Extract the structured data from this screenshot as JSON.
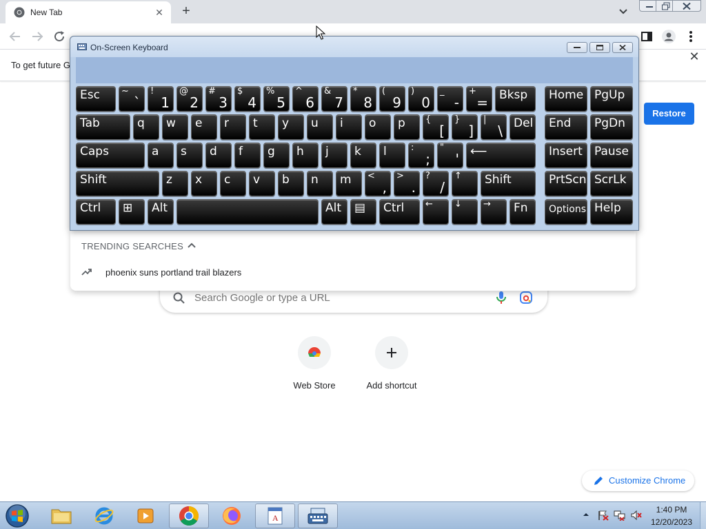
{
  "browser": {
    "tab_title": "New Tab",
    "infobar_text": "To get future G",
    "restore_label": "Restore"
  },
  "osk": {
    "title": "On-Screen Keyboard",
    "rows": [
      [
        {
          "label": "Esc",
          "w": 58
        },
        {
          "top": "~",
          "bot": "`",
          "w": 38
        },
        {
          "top": "!",
          "bot": "1",
          "w": 38
        },
        {
          "top": "@",
          "bot": "2",
          "w": 38
        },
        {
          "top": "#",
          "bot": "3",
          "w": 38
        },
        {
          "top": "$",
          "bot": "4",
          "w": 38
        },
        {
          "top": "%",
          "bot": "5",
          "w": 38
        },
        {
          "top": "^",
          "bot": "6",
          "w": 38
        },
        {
          "top": "&",
          "bot": "7",
          "w": 38
        },
        {
          "top": "*",
          "bot": "8",
          "w": 38
        },
        {
          "top": "(",
          "bot": "9",
          "w": 38
        },
        {
          "top": ")",
          "bot": "0",
          "w": 38
        },
        {
          "top": "_",
          "bot": "-",
          "w": 38
        },
        {
          "top": "+",
          "bot": "=",
          "w": 38
        },
        {
          "label": "Bksp",
          "w": 59
        },
        {
          "label": "Home",
          "w": 62,
          "gap": 9
        },
        {
          "label": "PgUp",
          "w": 62
        }
      ],
      [
        {
          "label": "Tab",
          "w": 79
        },
        {
          "label": "q",
          "w": 38
        },
        {
          "label": "w",
          "w": 38
        },
        {
          "label": "e",
          "w": 38
        },
        {
          "label": "r",
          "w": 38
        },
        {
          "label": "t",
          "w": 38
        },
        {
          "label": "y",
          "w": 38
        },
        {
          "label": "u",
          "w": 38
        },
        {
          "label": "i",
          "w": 38
        },
        {
          "label": "o",
          "w": 38
        },
        {
          "label": "p",
          "w": 38
        },
        {
          "top": "{",
          "bot": "[",
          "w": 38
        },
        {
          "top": "}",
          "bot": "]",
          "w": 38
        },
        {
          "top": "|",
          "bot": "\\",
          "w": 38
        },
        {
          "label": "Del",
          "w": 38
        },
        {
          "label": "End",
          "w": 62,
          "gap": 9
        },
        {
          "label": "PgDn",
          "w": 62
        }
      ],
      [
        {
          "label": "Caps",
          "w": 100
        },
        {
          "label": "a",
          "w": 38
        },
        {
          "label": "s",
          "w": 38
        },
        {
          "label": "d",
          "w": 38
        },
        {
          "label": "f",
          "w": 38
        },
        {
          "label": "g",
          "w": 38
        },
        {
          "label": "h",
          "w": 38
        },
        {
          "label": "j",
          "w": 38
        },
        {
          "label": "k",
          "w": 38
        },
        {
          "label": "l",
          "w": 38
        },
        {
          "top": ":",
          "bot": ";",
          "w": 38
        },
        {
          "top": "\"",
          "bot": "'",
          "w": 38
        },
        {
          "label": "⟵",
          "w": 101,
          "icon": "enter-icon"
        },
        {
          "label": "Insert",
          "w": 62,
          "gap": 9
        },
        {
          "label": "Pause",
          "w": 62
        }
      ],
      [
        {
          "label": "Shift",
          "w": 121
        },
        {
          "label": "z",
          "w": 38
        },
        {
          "label": "x",
          "w": 38
        },
        {
          "label": "c",
          "w": 38
        },
        {
          "label": "v",
          "w": 38
        },
        {
          "label": "b",
          "w": 38
        },
        {
          "label": "n",
          "w": 38
        },
        {
          "label": "m",
          "w": 38
        },
        {
          "top": "<",
          "bot": ",",
          "w": 38
        },
        {
          "top": ">",
          "bot": ".",
          "w": 38
        },
        {
          "top": "?",
          "bot": "/",
          "w": 38
        },
        {
          "top": "↑",
          "bot": "",
          "w": 38
        },
        {
          "label": "Shift",
          "w": 80
        },
        {
          "label": "PrtScn",
          "w": 62,
          "gap": 9
        },
        {
          "label": "ScrLk",
          "w": 62
        }
      ],
      [
        {
          "label": "Ctrl",
          "w": 58
        },
        {
          "label": "⊞",
          "w": 38,
          "icon": "windows-logo-icon"
        },
        {
          "label": "Alt",
          "w": 38
        },
        {
          "label": "",
          "w": 206,
          "icon": "spacebar"
        },
        {
          "label": "Alt",
          "w": 38
        },
        {
          "label": "▤",
          "w": 38,
          "icon": "context-menu-icon"
        },
        {
          "label": "Ctrl",
          "w": 59
        },
        {
          "top": "←",
          "bot": "",
          "w": 38
        },
        {
          "top": "↓",
          "bot": "",
          "w": 38
        },
        {
          "top": "→",
          "bot": "",
          "w": 38
        },
        {
          "label": "Fn",
          "w": 38
        },
        {
          "label": "Options",
          "w": 62,
          "gap": 9,
          "small": true
        },
        {
          "label": "Help",
          "w": 62
        }
      ]
    ]
  },
  "dropdown": {
    "trending_header": "TRENDING SEARCHES",
    "trending_items": [
      "phoenix suns portland trail blazers"
    ]
  },
  "ntp": {
    "search_placeholder": "Search Google or type a URL",
    "shortcuts": [
      {
        "label": "Web Store"
      },
      {
        "label": "Add shortcut"
      }
    ],
    "customize_label": "Customize Chrome"
  },
  "taskbar": {
    "items": [
      "start-orb",
      "explorer",
      "internet-explorer",
      "media-player",
      "chrome",
      "firefox",
      "notepad-app",
      "on-screen-keyboard"
    ],
    "clock_time": "1:40 PM",
    "clock_date": "12/20/2023"
  },
  "colors": {
    "accent": "#1a73e8",
    "osk_frame": "#bcd1ea",
    "taskbar": "#b4cce6"
  }
}
